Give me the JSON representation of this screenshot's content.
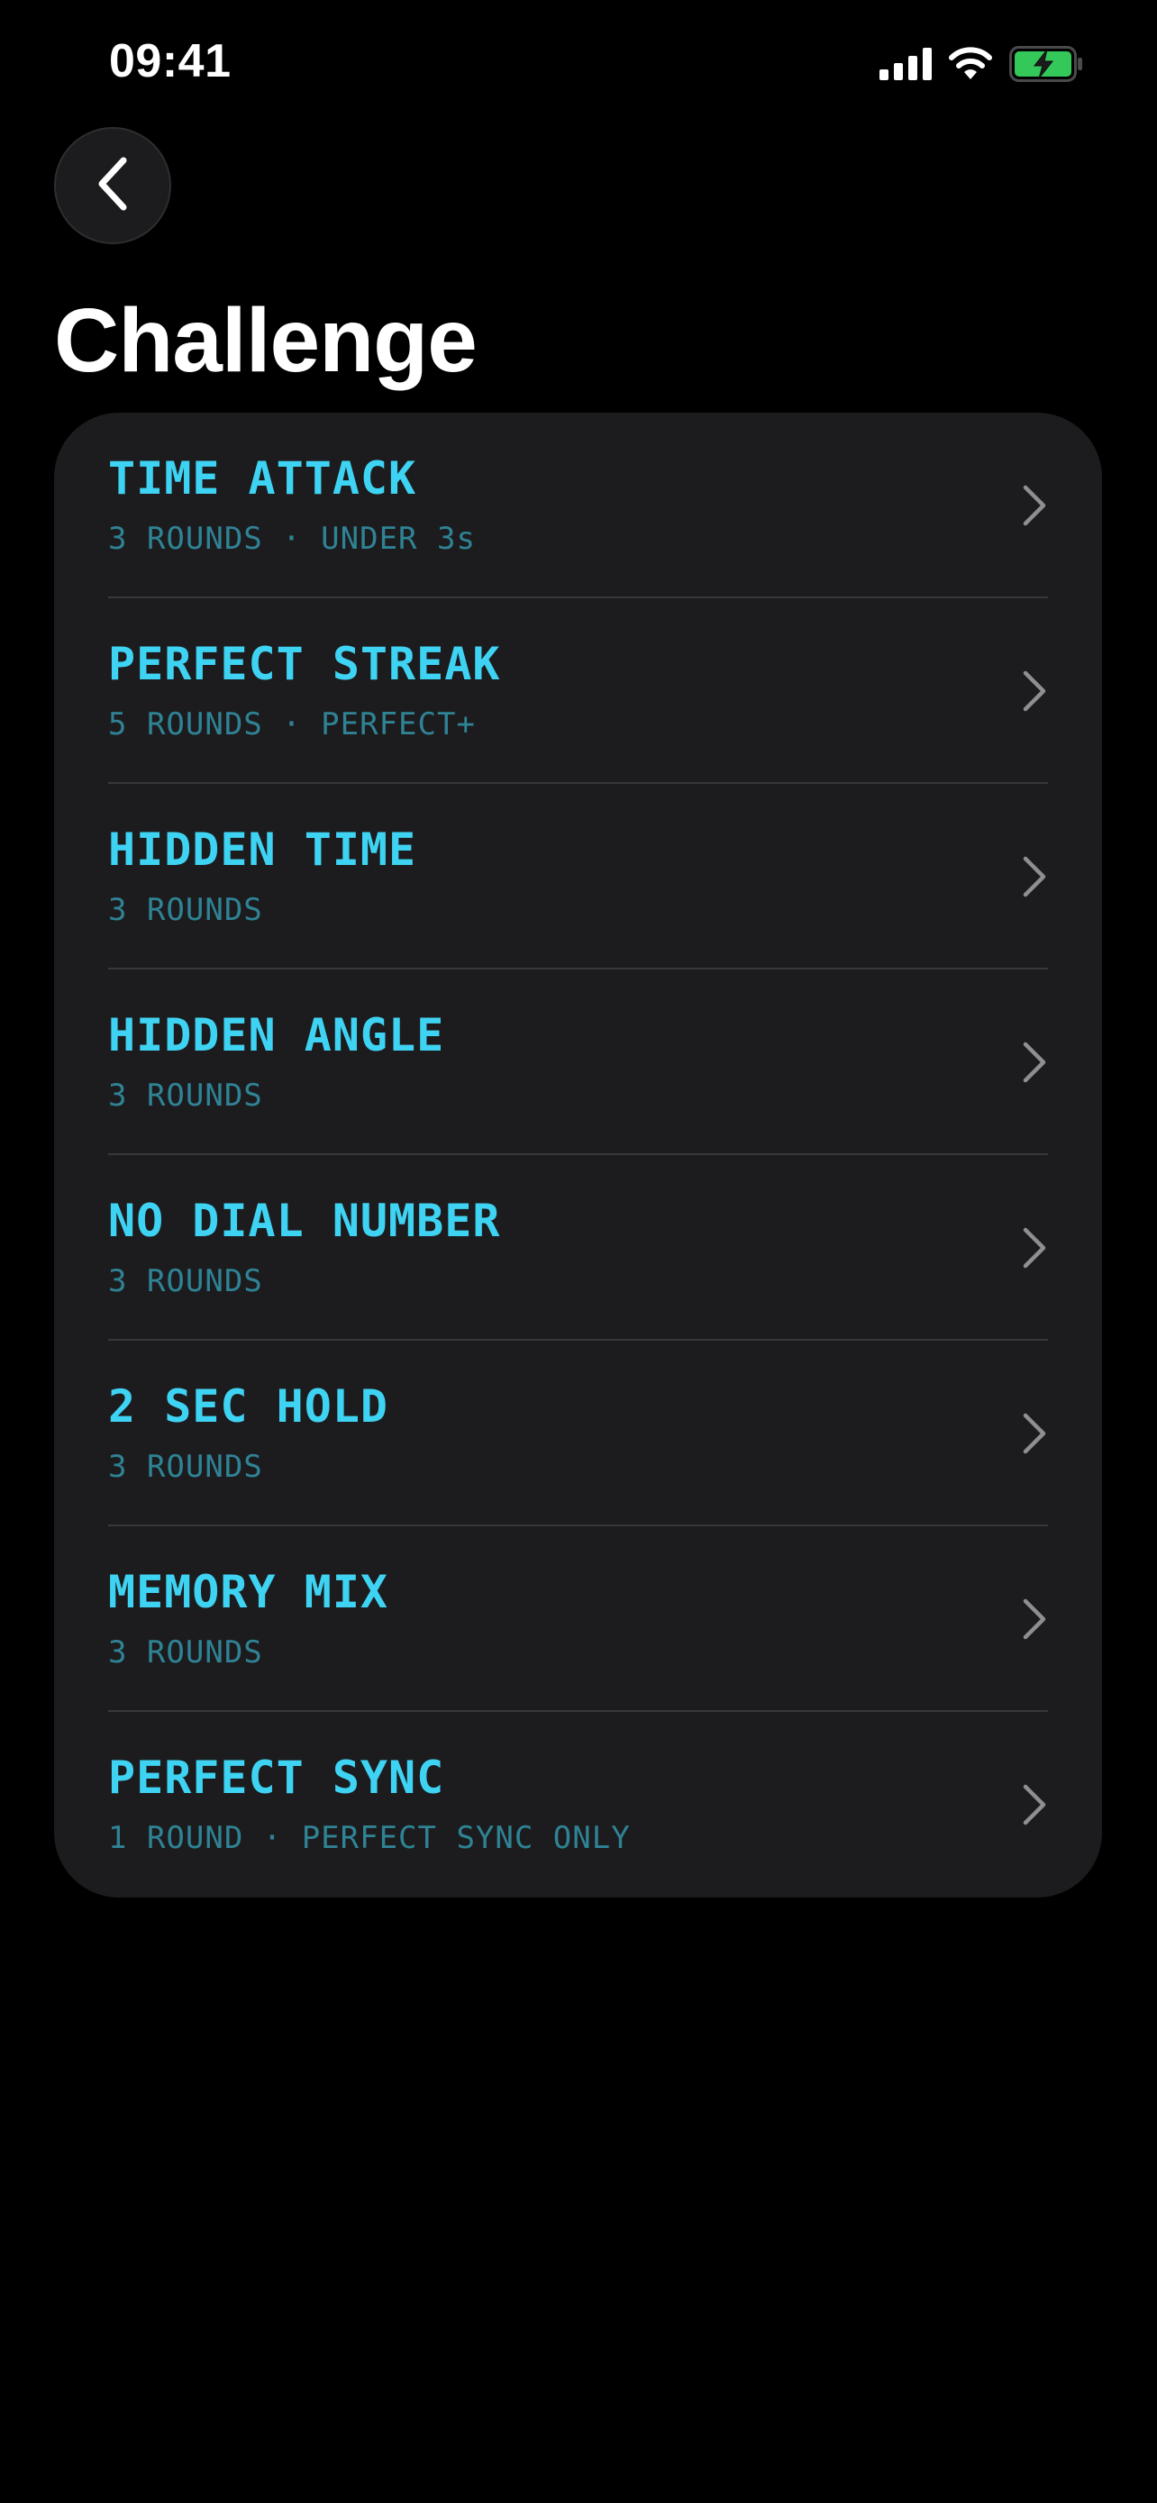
{
  "status_bar": {
    "time": "09:41",
    "icons": [
      "cellular-signal-icon",
      "wifi-icon",
      "battery-charging-icon"
    ],
    "battery_color": "#34c759"
  },
  "navigation": {
    "back_icon": "chevron-left-icon"
  },
  "page": {
    "title": "Challenge"
  },
  "colors": {
    "accent": "#3fd3f3",
    "subtitle": "#2f8395",
    "card_background": "#1c1c1e",
    "background": "#000000"
  },
  "challenges": [
    {
      "title": "TIME ATTACK",
      "subtitle": "3 ROUNDS · UNDER 3s"
    },
    {
      "title": "PERFECT STREAK",
      "subtitle": "5 ROUNDS · PERFECT+"
    },
    {
      "title": "HIDDEN TIME",
      "subtitle": "3 ROUNDS"
    },
    {
      "title": "HIDDEN ANGLE",
      "subtitle": "3 ROUNDS"
    },
    {
      "title": "NO DIAL NUMBER",
      "subtitle": "3 ROUNDS"
    },
    {
      "title": "2 SEC HOLD",
      "subtitle": "3 ROUNDS"
    },
    {
      "title": "MEMORY MIX",
      "subtitle": "3 ROUNDS"
    },
    {
      "title": "PERFECT SYNC",
      "subtitle": "1 ROUND · PERFECT SYNC ONLY"
    }
  ]
}
